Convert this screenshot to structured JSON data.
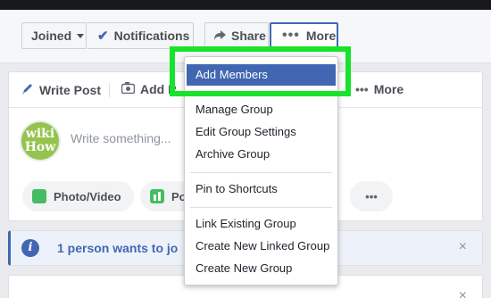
{
  "action_bar": {
    "joined_label": "Joined",
    "notifications_label": "Notifications",
    "share_label": "Share",
    "more_label": "More"
  },
  "composer": {
    "tabs": [
      {
        "label": "Write Post",
        "icon": "pencil-icon"
      },
      {
        "label": "Add P",
        "icon": "camera-icon"
      },
      {
        "label": "More",
        "icon": "dots-icon"
      }
    ],
    "avatar_text_line1": "wiki",
    "avatar_text_line2": "How",
    "placeholder": "Write something...",
    "pills": [
      {
        "label": "Photo/Video",
        "icon": "photo-icon"
      },
      {
        "label": "Po",
        "icon": "poll-icon"
      },
      {
        "label": "•••",
        "icon": "more-dots-icon"
      }
    ]
  },
  "notice": {
    "icon_label": "i",
    "text": "1 person wants to jo",
    "close_label": "×"
  },
  "bottom_card": {
    "close_label": "×"
  },
  "dropdown": {
    "items": [
      {
        "label": "Add Members"
      },
      {
        "label": "Manage Group"
      },
      {
        "label": "Edit Group Settings"
      },
      {
        "label": "Archive Group"
      },
      {
        "label": "Pin to Shortcuts"
      },
      {
        "label": "Link Existing Group"
      },
      {
        "label": "Create New Linked Group"
      },
      {
        "label": "Create New Group"
      }
    ],
    "selected_index": 0
  },
  "colors": {
    "accent": "#4267b2",
    "highlight": "#17e32b",
    "page_bg": "#e9ebee",
    "pill_green": "#45bd62"
  }
}
